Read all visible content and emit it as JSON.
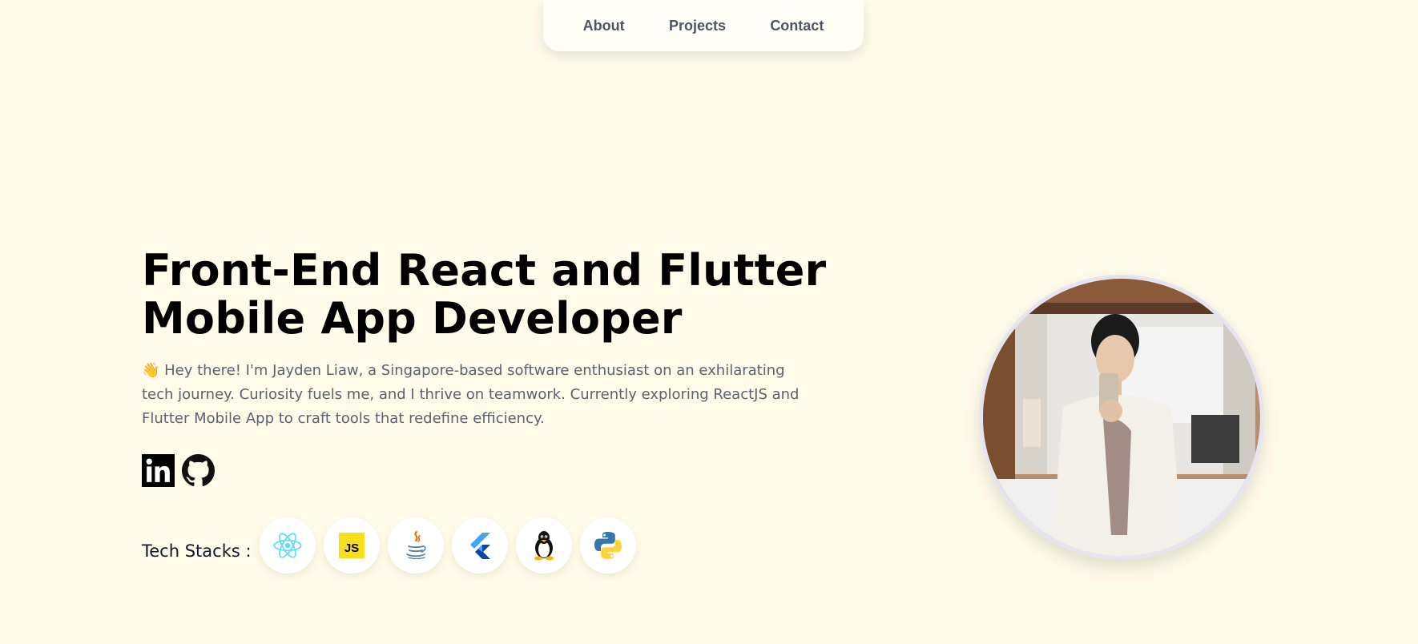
{
  "nav": {
    "items": [
      {
        "label": "About"
      },
      {
        "label": "Projects"
      },
      {
        "label": "Contact"
      }
    ]
  },
  "hero": {
    "title_line1": "Front-End React and Flutter",
    "title_line2": "Mobile App Developer",
    "intro": "👋 Hey there! I'm Jayden Liaw, a Singapore-based software enthusiast on an exhilarating tech journey. Curiosity fuels me, and I thrive on teamwork. Currently exploring ReactJS and Flutter Mobile App to craft tools that redefine efficiency."
  },
  "socials": [
    {
      "icon": "linkedin-icon"
    },
    {
      "icon": "github-icon"
    }
  ],
  "tech_stacks": {
    "label": "Tech Stacks :",
    "items": [
      {
        "icon": "react-icon",
        "color": "#61dafb"
      },
      {
        "icon": "javascript-icon",
        "color": "#f7df1e",
        "text": "JS"
      },
      {
        "icon": "java-icon",
        "color": "#e76f00"
      },
      {
        "icon": "flutter-icon",
        "color": "#42a5f5"
      },
      {
        "icon": "linux-tux-icon",
        "color": "#000000"
      },
      {
        "icon": "python-icon",
        "color": "#3776ab"
      }
    ]
  },
  "colors": {
    "background": "#fefbe8",
    "nav_text": "#4b5563",
    "body_text": "#5b6270",
    "title_text": "#000000"
  }
}
